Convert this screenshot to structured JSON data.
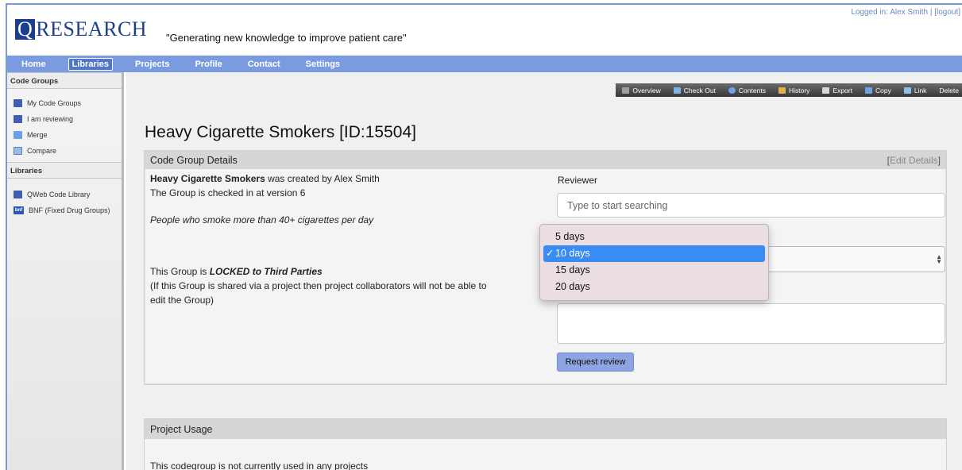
{
  "header": {
    "logo_q": "Q",
    "logo_rest": "RESEARCH",
    "tagline": "\"Generating new knowledge to improve patient care\"",
    "user_text": "Logged in: Alex Smith | [logout]"
  },
  "nav": {
    "items": [
      {
        "label": "Home"
      },
      {
        "label": "Libraries",
        "active": true
      },
      {
        "label": "Projects"
      },
      {
        "label": "Profile"
      },
      {
        "label": "Contact"
      },
      {
        "label": "Settings"
      }
    ]
  },
  "sidebar": {
    "code_groups_head": "Code Groups",
    "code_groups": [
      {
        "label": "My Code Groups",
        "icon": "book-icon"
      },
      {
        "label": "I am reviewing",
        "icon": "book-icon"
      },
      {
        "label": "Merge",
        "icon": "merge-icon"
      },
      {
        "label": "Compare",
        "icon": "compare-icon"
      }
    ],
    "libraries_head": "Libraries",
    "libraries": [
      {
        "label": "QWeb Code Library",
        "icon": "book-icon"
      },
      {
        "label": "BNF (Fixed Drug Groups)",
        "icon": "bnf-icon",
        "icon_text": "bnf"
      }
    ]
  },
  "toolbar": {
    "items": [
      {
        "label": "Overview",
        "icon": "home-icon"
      },
      {
        "label": "Check Out",
        "icon": "checkout-icon"
      },
      {
        "label": "Contents",
        "icon": "search-icon"
      },
      {
        "label": "History",
        "icon": "history-icon"
      },
      {
        "label": "Export",
        "icon": "export-icon"
      },
      {
        "label": "Copy",
        "icon": "copy-icon"
      },
      {
        "label": "Link",
        "icon": "link-icon"
      },
      {
        "label": "Delete",
        "icon": ""
      }
    ]
  },
  "page": {
    "title": "Heavy Cigarette Smokers [ID:15504]"
  },
  "details": {
    "head": "Code Group Details",
    "edit_label": "Edit Details",
    "group_name": "Heavy Cigarette Smokers",
    "created_suffix": " was created by Alex Smith",
    "version_text": "The Group is checked in at version 6",
    "description": "People who smoke more than 40+ cigarettes per day",
    "locked_prefix": "This Group is ",
    "locked_text": "LOCKED to Third Parties",
    "locked_note_line1": "(If this Group is shared via a project then project collaborators will not be able to",
    "locked_note_line2": "edit the Group)",
    "reviewer_label": "Reviewer",
    "reviewer_placeholder": "Type to start searching",
    "request_button": "Request review"
  },
  "dropdown": {
    "options": [
      "5 days",
      "10 days",
      "15 days",
      "20 days"
    ],
    "selected": "10 days",
    "check": "✓"
  },
  "usage": {
    "head": "Project Usage",
    "text": "This codegroup is not currently used in any projects"
  },
  "colors": {
    "nav_bg": "#7b9be0",
    "logo": "#1d3d8f",
    "selected_option": "#3a8cf4",
    "button": "#8ea5e4"
  }
}
